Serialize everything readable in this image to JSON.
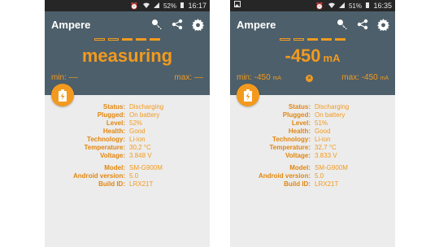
{
  "accent_color": "#f39a1e",
  "header_color": "#4d5f6a",
  "left": {
    "statusbar": {
      "battery": "52%",
      "time": "16:17"
    },
    "app_title": "Ampere",
    "reading_text": "measuring",
    "min": "min: ––",
    "max": "max: ––",
    "status": [
      {
        "label": "Status:",
        "value": "Discharging"
      },
      {
        "label": "Plugged:",
        "value": "On battery"
      },
      {
        "label": "Level:",
        "value": "52%"
      },
      {
        "label": "Health:",
        "value": "Good"
      },
      {
        "label": "Technology:",
        "value": "Li-ion"
      },
      {
        "label": "Temperature:",
        "value": "30,2 °C"
      },
      {
        "label": "Voltage:",
        "value": "3.848 V"
      }
    ],
    "device": [
      {
        "label": "Model:",
        "value": "SM-G900M"
      },
      {
        "label": "Android version:",
        "value": "5.0"
      },
      {
        "label": "Build ID:",
        "value": "LRX21T"
      }
    ]
  },
  "right": {
    "statusbar": {
      "battery": "51%",
      "time": "16:35"
    },
    "app_title": "Ampere",
    "reading_value": "-450",
    "reading_unit": "mA",
    "min_label": "min: -450",
    "min_unit": "mA",
    "max_label": "max: -450",
    "max_unit": "mA",
    "status": [
      {
        "label": "Status:",
        "value": "Discharging"
      },
      {
        "label": "Plugged:",
        "value": "On battery"
      },
      {
        "label": "Level:",
        "value": "51%"
      },
      {
        "label": "Health:",
        "value": "Good"
      },
      {
        "label": "Technology:",
        "value": "Li-ion"
      },
      {
        "label": "Temperature:",
        "value": "32,7 °C"
      },
      {
        "label": "Voltage:",
        "value": "3.833 V"
      }
    ],
    "device": [
      {
        "label": "Model:",
        "value": "SM-G900M"
      },
      {
        "label": "Android version:",
        "value": "5.0"
      },
      {
        "label": "Build ID:",
        "value": "LRX21T"
      }
    ]
  }
}
